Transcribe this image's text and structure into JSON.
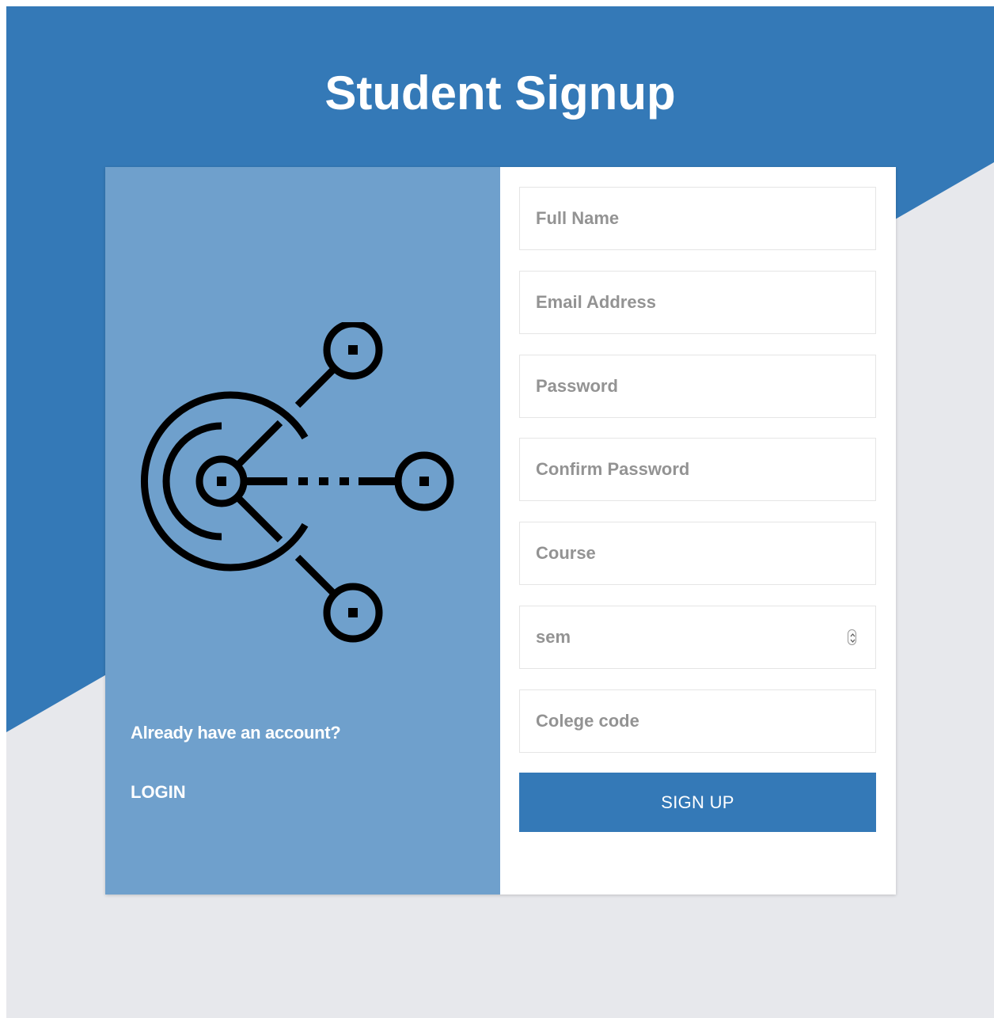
{
  "page": {
    "title": "Student Signup"
  },
  "colors": {
    "primary": "#3479b7",
    "left_panel": "#6fa0cc",
    "background": "#e7e8ec"
  },
  "left_panel": {
    "illustration_icon": "network-hub-icon",
    "account_question": "Already have an account?",
    "login_label": "LOGIN"
  },
  "form": {
    "full_name": {
      "placeholder": "Full Name",
      "value": ""
    },
    "email": {
      "placeholder": "Email Address",
      "value": ""
    },
    "password": {
      "placeholder": "Password",
      "value": ""
    },
    "confirm_password": {
      "placeholder": "Confirm Password",
      "value": ""
    },
    "course": {
      "placeholder": "Course",
      "value": ""
    },
    "sem": {
      "placeholder": "sem",
      "value": ""
    },
    "college_code": {
      "placeholder": "Colege code",
      "value": ""
    },
    "submit_label": "SIGN UP"
  }
}
